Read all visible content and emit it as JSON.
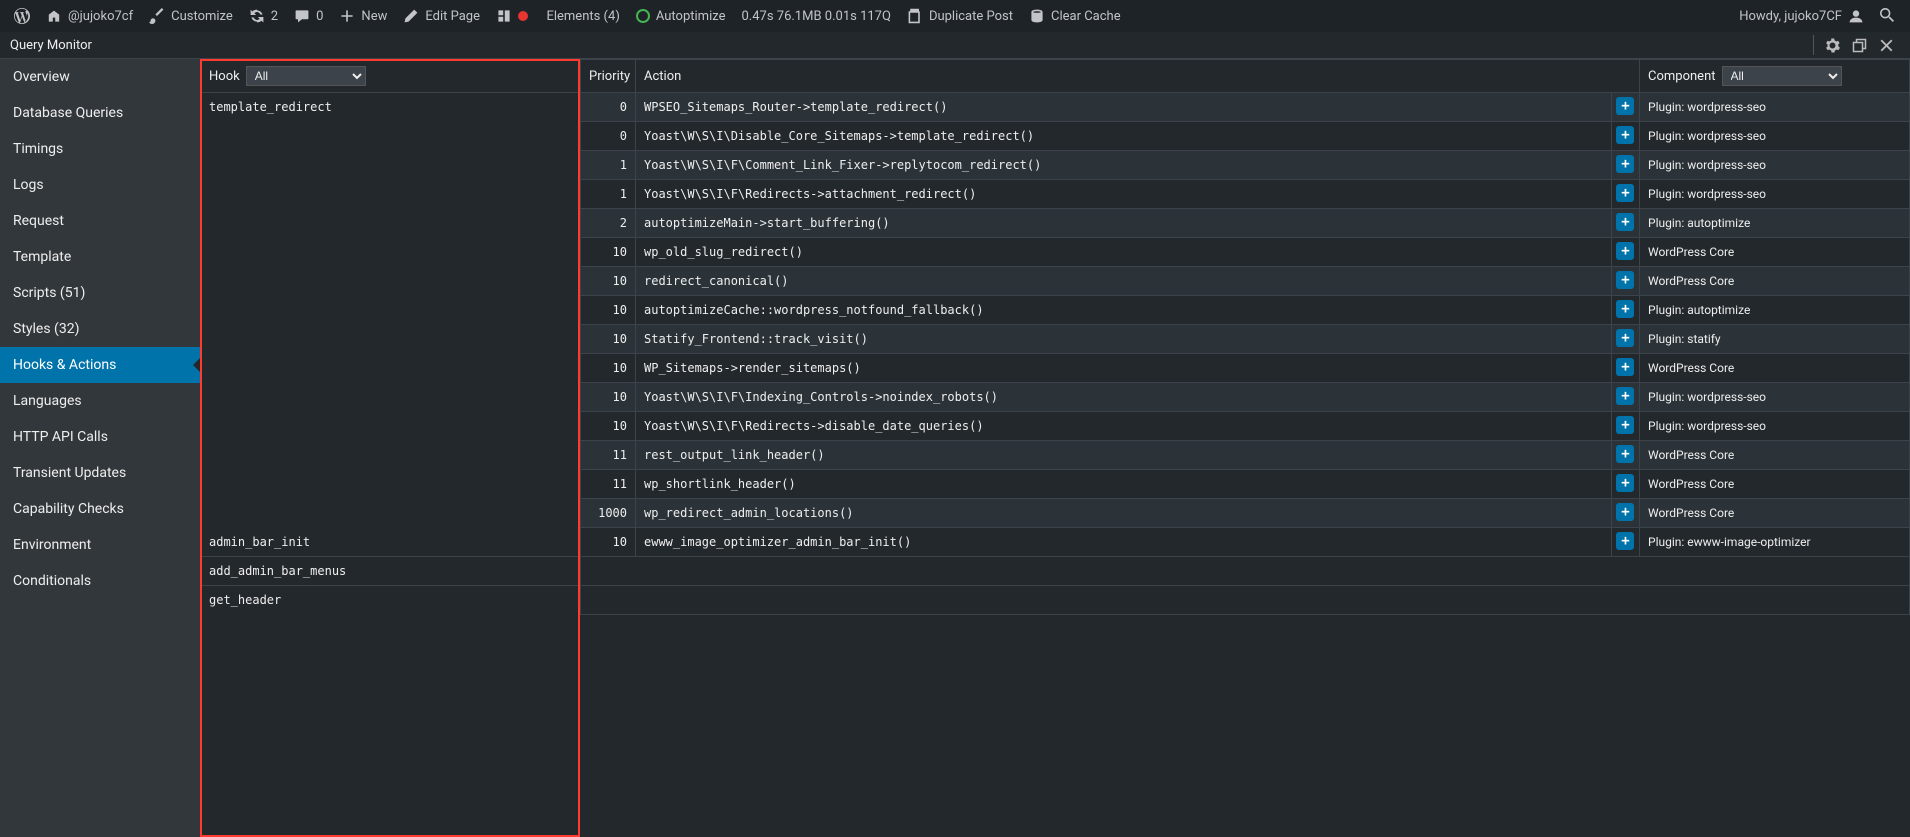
{
  "adminbar": {
    "site": "@jujoko7cf",
    "customize": "Customize",
    "updates": "2",
    "comments": "0",
    "new": "New",
    "edit_page": "Edit Page",
    "elements": "Elements (4)",
    "autoptimize": "Autoptimize",
    "perf": "0.47s 76.1MB 0.01s 117Q",
    "duplicate": "Duplicate Post",
    "clear_cache": "Clear Cache",
    "howdy": "Howdy, jujoko7CF"
  },
  "qm": {
    "title": "Query Monitor",
    "nav": [
      {
        "label": "Overview"
      },
      {
        "label": "Database Queries"
      },
      {
        "label": "Timings"
      },
      {
        "label": "Logs"
      },
      {
        "label": "Request"
      },
      {
        "label": "Template"
      },
      {
        "label": "Scripts (51)"
      },
      {
        "label": "Styles (32)"
      },
      {
        "label": "Hooks & Actions",
        "active": true
      },
      {
        "label": "Languages"
      },
      {
        "label": "HTTP API Calls"
      },
      {
        "label": "Transient Updates"
      },
      {
        "label": "Capability Checks"
      },
      {
        "label": "Environment"
      },
      {
        "label": "Conditionals"
      }
    ],
    "columns": {
      "hook": "Hook",
      "priority": "Priority",
      "action": "Action",
      "component": "Component"
    },
    "filter_all": "All",
    "hooks": [
      {
        "name": "template_redirect",
        "rows": [
          {
            "p": "0",
            "a": "WPSEO_Sitemaps_Router->template_redirect()",
            "c": "Plugin: wordpress-seo"
          },
          {
            "p": "0",
            "a": "Yoast\\W\\S\\I\\Disable_Core_Sitemaps->template_redirect()",
            "c": "Plugin: wordpress-seo"
          },
          {
            "p": "1",
            "a": "Yoast\\W\\S\\I\\F\\Comment_Link_Fixer->replytocom_redirect()",
            "c": "Plugin: wordpress-seo"
          },
          {
            "p": "1",
            "a": "Yoast\\W\\S\\I\\F\\Redirects->attachment_redirect()",
            "c": "Plugin: wordpress-seo"
          },
          {
            "p": "2",
            "a": "autoptimizeMain->start_buffering()",
            "c": "Plugin: autoptimize"
          },
          {
            "p": "10",
            "a": "wp_old_slug_redirect()",
            "c": "WordPress Core"
          },
          {
            "p": "10",
            "a": "redirect_canonical()",
            "c": "WordPress Core"
          },
          {
            "p": "10",
            "a": "autoptimizeCache::wordpress_notfound_fallback()",
            "c": "Plugin: autoptimize"
          },
          {
            "p": "10",
            "a": "Statify_Frontend::track_visit()",
            "c": "Plugin: statify"
          },
          {
            "p": "10",
            "a": "WP_Sitemaps->render_sitemaps()",
            "c": "WordPress Core"
          },
          {
            "p": "10",
            "a": "Yoast\\W\\S\\I\\F\\Indexing_Controls->noindex_robots()",
            "c": "Plugin: wordpress-seo"
          },
          {
            "p": "10",
            "a": "Yoast\\W\\S\\I\\F\\Redirects->disable_date_queries()",
            "c": "Plugin: wordpress-seo"
          },
          {
            "p": "11",
            "a": "rest_output_link_header()",
            "c": "WordPress Core"
          },
          {
            "p": "11",
            "a": "wp_shortlink_header()",
            "c": "WordPress Core"
          },
          {
            "p": "1000",
            "a": "wp_redirect_admin_locations()",
            "c": "WordPress Core"
          }
        ]
      },
      {
        "name": "admin_bar_init",
        "rows": [
          {
            "p": "10",
            "a": "ewww_image_optimizer_admin_bar_init()",
            "c": "Plugin: ewww-image-optimizer"
          }
        ]
      },
      {
        "name": "add_admin_bar_menus"
      },
      {
        "name": "get_header"
      }
    ]
  }
}
